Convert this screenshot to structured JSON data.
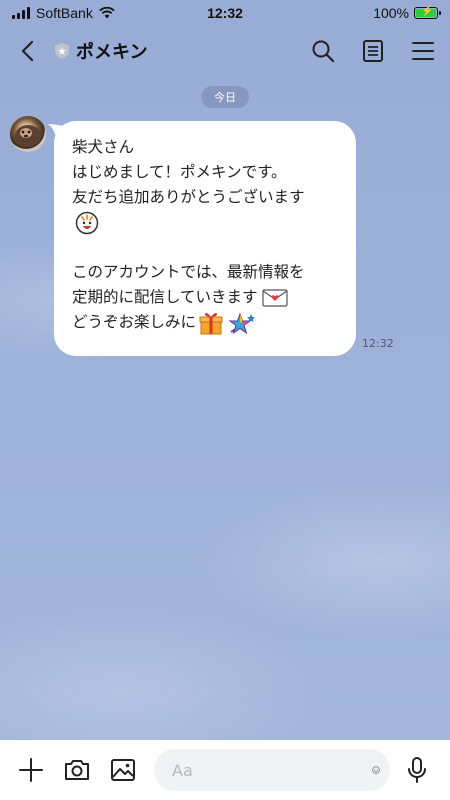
{
  "status_bar": {
    "carrier": "SoftBank",
    "time": "12:32",
    "battery_percent": "100%",
    "battery_level": 1.0
  },
  "header": {
    "back_icon": "chevron-left-icon",
    "title": "ポメキン",
    "badge_icon": "official-account-shield-icon",
    "search_icon": "search-icon",
    "notes_icon": "notes-icon",
    "menu_icon": "hamburger-menu-icon"
  },
  "chat": {
    "date_label": "今日",
    "messages": [
      {
        "sender_avatar": "dog-avatar",
        "lines": [
          "柴犬さん",
          "はじめまして！ポメキンです。",
          "友だち追加ありがとうございます",
          "",
          "",
          "このアカウントでは、最新情報を",
          "定期的に配信していきます",
          "どうぞお楽しみに"
        ],
        "emojis": [
          "grinning-character-emoji",
          "love-letter-emoji",
          "gift-emoji",
          "shooting-star-emoji"
        ],
        "time": "12:32"
      }
    ]
  },
  "input_bar": {
    "add_icon": "plus-icon",
    "camera_icon": "camera-icon",
    "image_icon": "image-icon",
    "placeholder": "Aa",
    "value": "",
    "emoji_icon": "smiley-icon",
    "mic_icon": "microphone-icon"
  }
}
